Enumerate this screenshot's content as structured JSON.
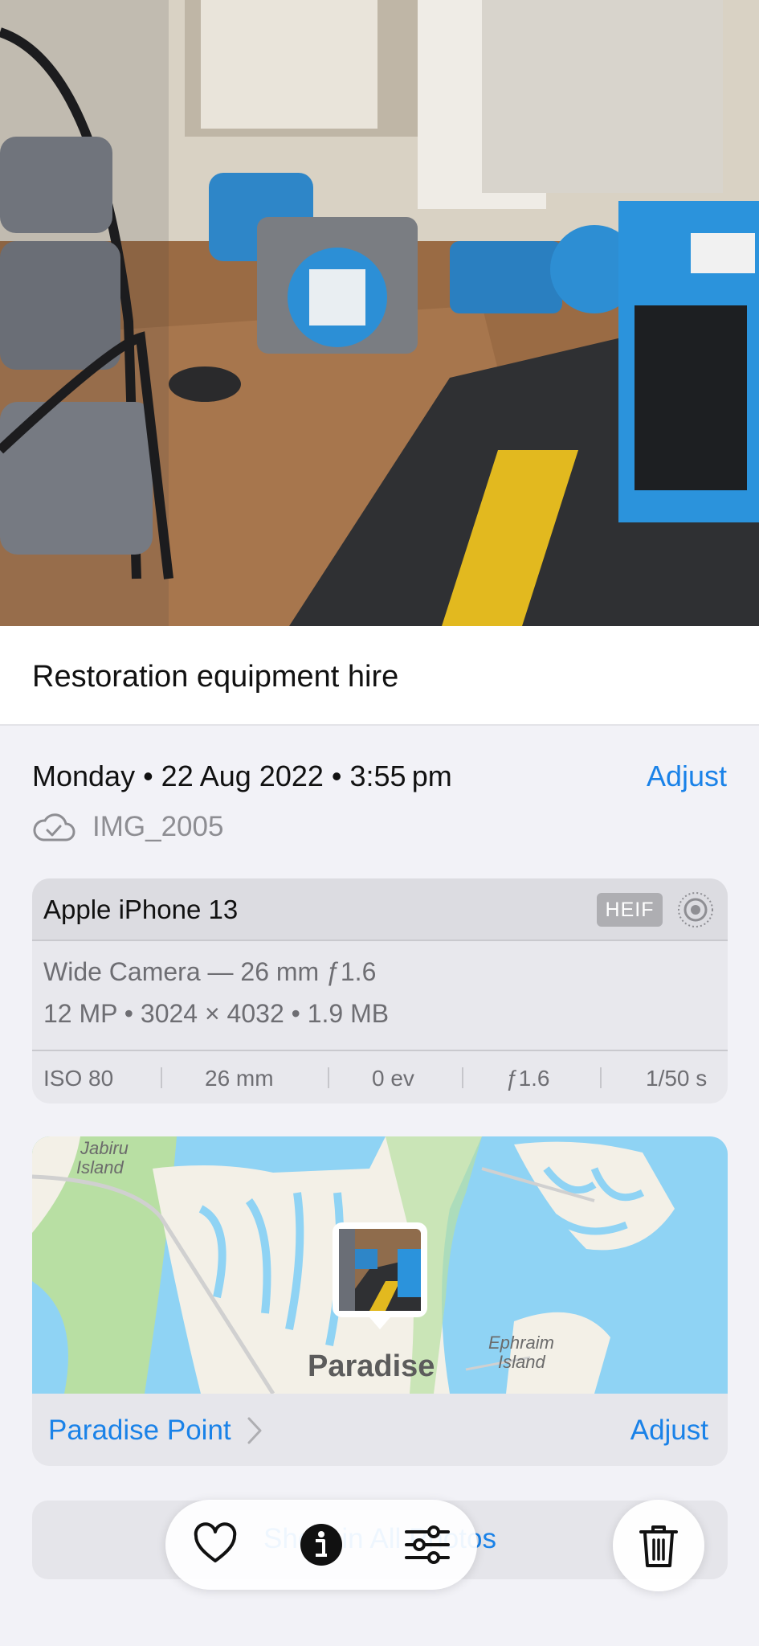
{
  "caption": "Restoration equipment hire",
  "date": {
    "text": "Monday • 22 Aug 2022 • 3:55 pm",
    "adjust_label": "Adjust"
  },
  "file": {
    "name": "IMG_2005",
    "icon": "cloud-check-icon"
  },
  "camera": {
    "model": "Apple iPhone 13",
    "format_badge": "HEIF",
    "live_icon": "live-photo-icon",
    "lens": "Wide Camera — 26 mm ƒ1.6",
    "specs": "12 MP • 3024 × 4032 • 1.9 MB",
    "exif": [
      "ISO 80",
      "26 mm",
      "0 ev",
      "ƒ1.6",
      "1/50 s"
    ]
  },
  "map": {
    "labels": {
      "jabiru": "Jabiru\nIsland",
      "paradise": "Paradise",
      "ephraim": "Ephraim\nIsland"
    },
    "location_name": "Paradise Point",
    "adjust_label": "Adjust"
  },
  "show_all_label": "Show in All Photos",
  "toolbar": {
    "favorite_icon": "heart-icon",
    "info_icon": "info-icon",
    "edit_icon": "sliders-icon",
    "delete_icon": "trash-icon"
  },
  "colors": {
    "accent": "#1a82e8",
    "water": "#8fd3f4",
    "land": "#f3f0e7",
    "park": "#b8dfa3"
  }
}
